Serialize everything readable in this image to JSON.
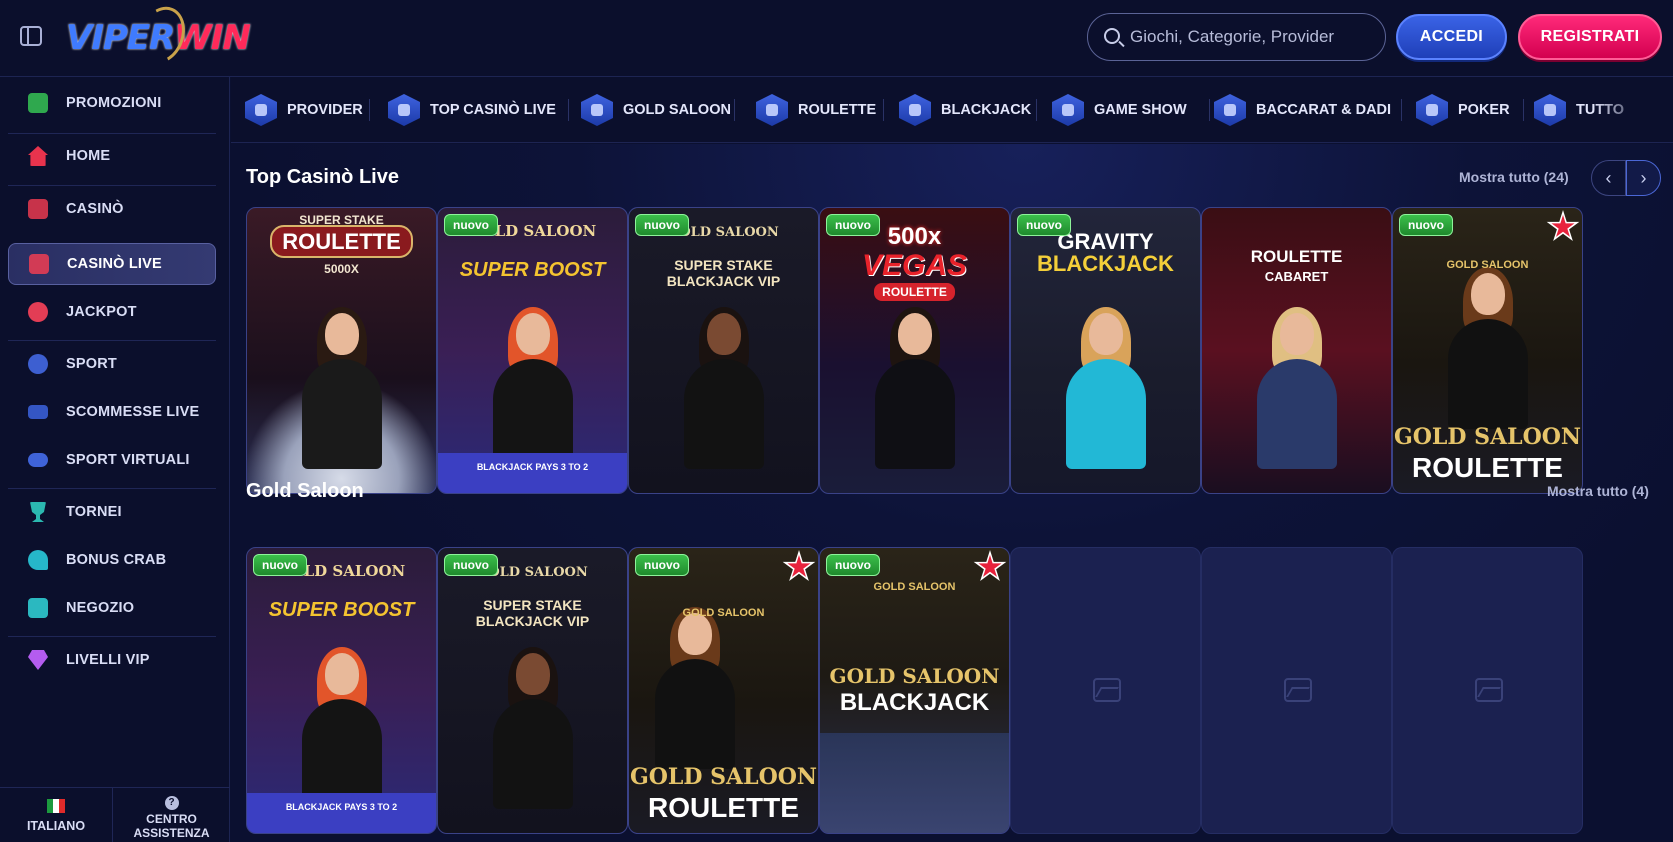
{
  "brand": {
    "logo_a": "VIPER",
    "logo_b": "WIN"
  },
  "header": {
    "search_placeholder": "Giochi, Categorie, Provider",
    "login_label": "ACCEDI",
    "register_label": "REGISTRATI"
  },
  "sidebar": {
    "items": [
      {
        "label": "PROMOZIONI",
        "icon": "gift-icon"
      },
      {
        "label": "HOME",
        "icon": "home-icon"
      },
      {
        "label": "CASINÒ",
        "icon": "slot-machine-icon"
      },
      {
        "label": "CASINÒ LIVE",
        "icon": "live-casino-icon"
      },
      {
        "label": "JACKPOT",
        "icon": "clover-icon"
      },
      {
        "label": "SPORT",
        "icon": "ball-icon"
      },
      {
        "label": "SCOMMESSE LIVE",
        "icon": "live-tv-icon"
      },
      {
        "label": "SPORT VIRTUALI",
        "icon": "gamepad-icon"
      },
      {
        "label": "TORNEI",
        "icon": "trophy-icon"
      },
      {
        "label": "BONUS CRAB",
        "icon": "crab-icon"
      },
      {
        "label": "NEGOZIO",
        "icon": "shop-icon"
      },
      {
        "label": "LIVELLI VIP",
        "icon": "diamond-icon"
      }
    ],
    "footer": {
      "language": "ITALIANO",
      "help_line1": "CENTRO",
      "help_line2": "ASSISTENZA"
    }
  },
  "categories": [
    "PROVIDER",
    "TOP CASINÒ LIVE",
    "GOLD SALOON",
    "ROULETTE",
    "BLACKJACK",
    "GAME SHOW",
    "BACCARAT & DADI",
    "POKER",
    "TUTTO"
  ],
  "sections": {
    "top": {
      "title": "Top Casinò Live",
      "show_all": "Mostra tutto (24)",
      "cards": [
        {
          "line1": "SUPER STAKE",
          "line2": "ROULETTE",
          "line3": "5000X",
          "badge": ""
        },
        {
          "line1": "GOLD SALOON",
          "line2": "SUPER BOOST",
          "line3": "BLACKJACK PAYS 3 TO 2",
          "badge": "nuovo"
        },
        {
          "line1": "GOLD SALOON",
          "line2": "SUPER STAKE",
          "line3": "BLACKJACK VIP",
          "badge": "nuovo"
        },
        {
          "line1": "500x",
          "line2": "VEGAS",
          "line3": "ROULETTE",
          "badge": "nuovo"
        },
        {
          "line1": "GRAVITY",
          "line2": "BLACKJACK",
          "line3": "",
          "badge": "nuovo"
        },
        {
          "line1": "ROULETTE",
          "line2": "CABARET",
          "line3": "",
          "badge": ""
        },
        {
          "line1": "GOLD SALOON",
          "line2": "GOLD SALOON",
          "line3": "ROULETTE",
          "badge": "nuovo"
        }
      ]
    },
    "gold": {
      "title": "Gold Saloon",
      "show_all": "Mostra tutto (4)",
      "cards": [
        {
          "line1": "GOLD SALOON",
          "line2": "SUPER BOOST",
          "line3": "BLACKJACK PAYS 3 TO 2",
          "badge": "nuovo"
        },
        {
          "line1": "GOLD SALOON",
          "line2": "SUPER STAKE",
          "line3": "BLACKJACK VIP",
          "badge": "nuovo"
        },
        {
          "line1": "GOLD SALOON",
          "line2": "GOLD SALOON",
          "line3": "ROULETTE",
          "badge": "nuovo"
        },
        {
          "line1": "GOLD SALOON",
          "line2": "GOLD SALOON",
          "line3": "BLACKJACK",
          "badge": "nuovo"
        }
      ]
    }
  },
  "colors": {
    "accent_blue": "#3a63e6",
    "accent_pink": "#ff2a7a",
    "badge_green": "#2aa83a",
    "gold": "#e6c46a"
  }
}
